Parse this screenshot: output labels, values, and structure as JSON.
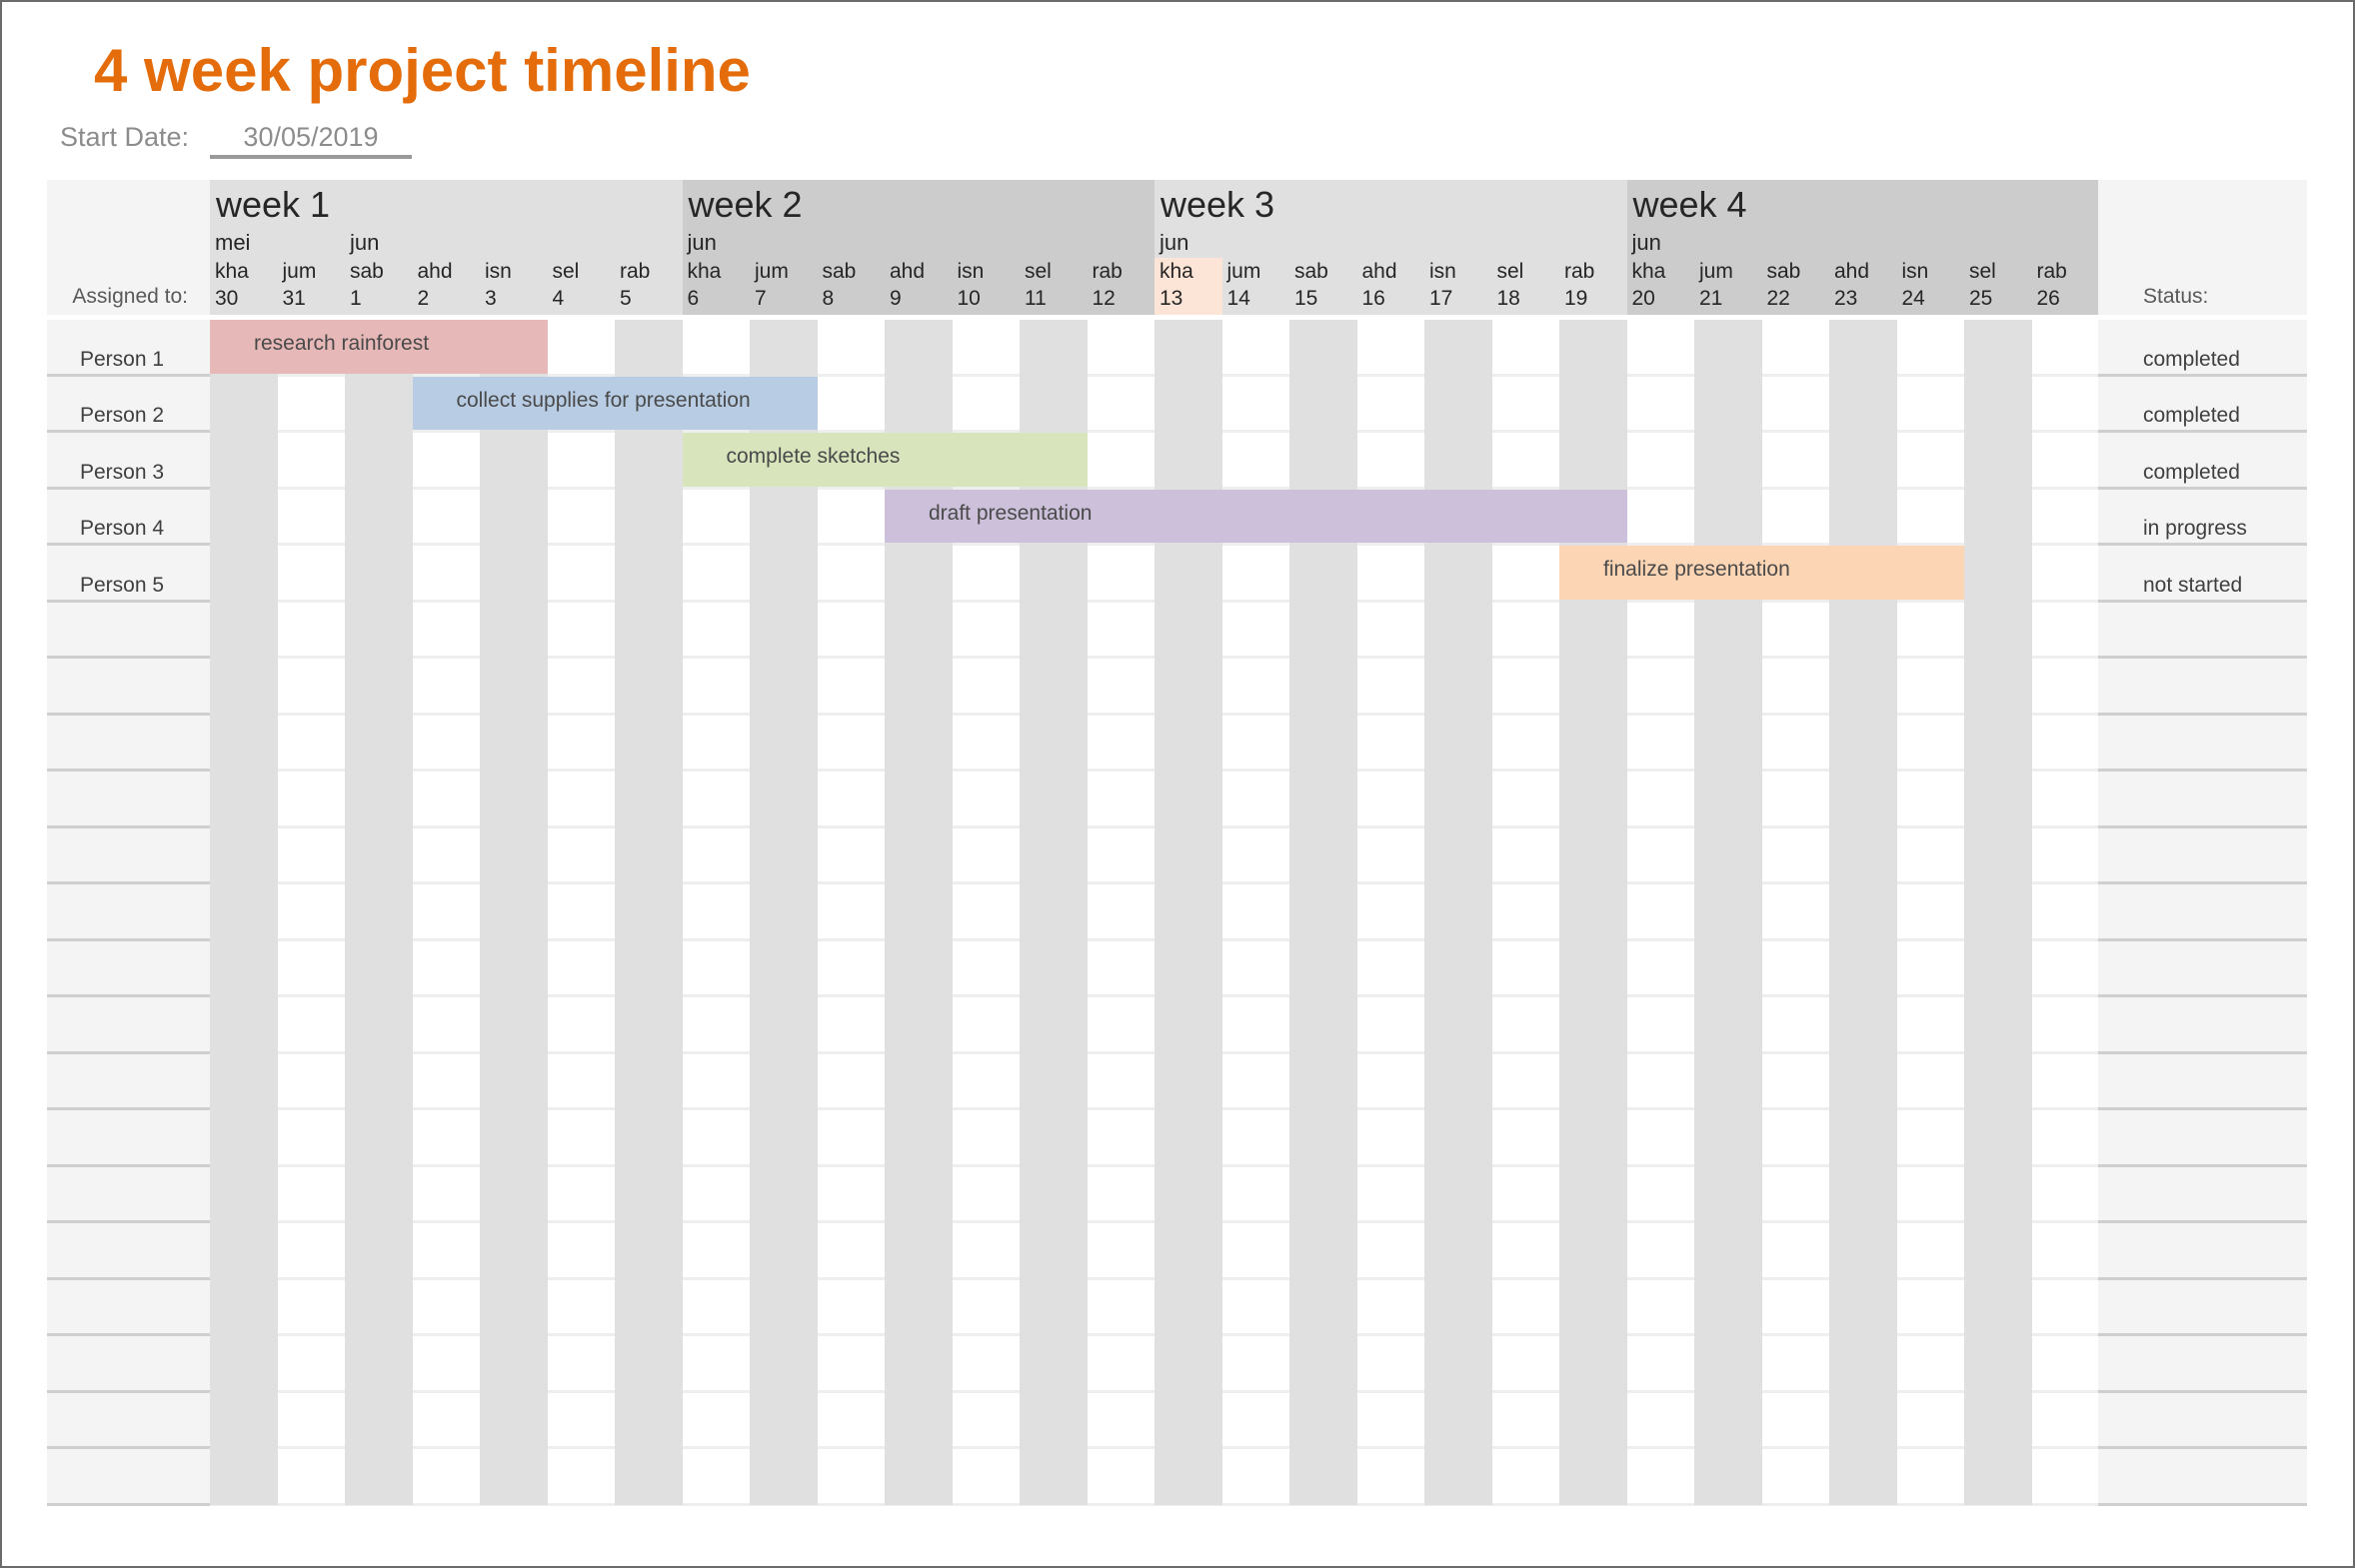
{
  "title": "4 week project timeline",
  "start_date": {
    "label": "Start Date:",
    "value": "30/05/2019"
  },
  "header": {
    "assigned_label": "Assigned to:",
    "status_label": "Status:",
    "weeks": [
      {
        "label": "week 1",
        "color": "#e0e0e0"
      },
      {
        "label": "week 2",
        "color": "#cccccc"
      },
      {
        "label": "week 3",
        "color": "#e0e0e0"
      },
      {
        "label": "week 4",
        "color": "#cccccc"
      }
    ],
    "highlight_color": "#fce4d6",
    "days": [
      {
        "month": "mei",
        "name": "kha",
        "num": "30"
      },
      {
        "month": "",
        "name": "jum",
        "num": "31"
      },
      {
        "month": "jun",
        "name": "sab",
        "num": "1"
      },
      {
        "month": "",
        "name": "ahd",
        "num": "2"
      },
      {
        "month": "",
        "name": "isn",
        "num": "3"
      },
      {
        "month": "",
        "name": "sel",
        "num": "4"
      },
      {
        "month": "",
        "name": "rab",
        "num": "5"
      },
      {
        "month": "jun",
        "name": "kha",
        "num": "6"
      },
      {
        "month": "",
        "name": "jum",
        "num": "7"
      },
      {
        "month": "",
        "name": "sab",
        "num": "8"
      },
      {
        "month": "",
        "name": "ahd",
        "num": "9"
      },
      {
        "month": "",
        "name": "isn",
        "num": "10"
      },
      {
        "month": "",
        "name": "sel",
        "num": "11"
      },
      {
        "month": "",
        "name": "rab",
        "num": "12"
      },
      {
        "month": "jun",
        "name": "kha",
        "num": "13",
        "highlight": true
      },
      {
        "month": "",
        "name": "jum",
        "num": "14"
      },
      {
        "month": "",
        "name": "sab",
        "num": "15"
      },
      {
        "month": "",
        "name": "ahd",
        "num": "16"
      },
      {
        "month": "",
        "name": "isn",
        "num": "17"
      },
      {
        "month": "",
        "name": "sel",
        "num": "18"
      },
      {
        "month": "",
        "name": "rab",
        "num": "19"
      },
      {
        "month": "jun",
        "name": "kha",
        "num": "20"
      },
      {
        "month": "",
        "name": "jum",
        "num": "21"
      },
      {
        "month": "",
        "name": "sab",
        "num": "22"
      },
      {
        "month": "",
        "name": "ahd",
        "num": "23"
      },
      {
        "month": "",
        "name": "isn",
        "num": "24"
      },
      {
        "month": "",
        "name": "sel",
        "num": "25"
      },
      {
        "month": "",
        "name": "rab",
        "num": "26"
      }
    ]
  },
  "tasks": [
    {
      "person": "Person 1",
      "task": "research rainforest",
      "start_day_index": 0,
      "end_day_index": 4,
      "color": "#e6b8b7",
      "status": "completed"
    },
    {
      "person": "Person 2",
      "task": "collect supplies for presentation",
      "start_day_index": 3,
      "end_day_index": 8,
      "color": "#b8cce4",
      "status": "completed"
    },
    {
      "person": "Person 3",
      "task": "complete sketches",
      "start_day_index": 7,
      "end_day_index": 12,
      "color": "#d8e4bc",
      "status": "completed"
    },
    {
      "person": "Person 4",
      "task": "draft presentation",
      "start_day_index": 10,
      "end_day_index": 20,
      "color": "#ccc0da",
      "status": "in progress"
    },
    {
      "person": "Person 5",
      "task": "finalize presentation",
      "start_day_index": 20,
      "end_day_index": 25,
      "color": "#fcd5b4",
      "status": "not started"
    }
  ],
  "empty_rows": 16,
  "colors": {
    "title": "#e46c0a",
    "stripe": "#e0e0e0"
  }
}
